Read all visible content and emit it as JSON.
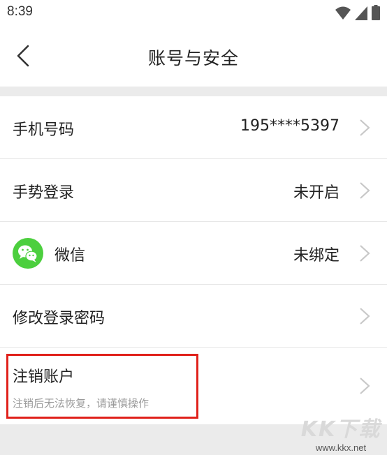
{
  "status_bar": {
    "time": "8:39",
    "icons": [
      "wifi-icon",
      "signal-icon",
      "battery-icon"
    ]
  },
  "header": {
    "title": "账号与安全",
    "back_icon": "back-arrow-icon"
  },
  "rows": [
    {
      "label": "手机号码",
      "value": "195****5397"
    },
    {
      "label": "手势登录",
      "value": "未开启"
    },
    {
      "label": "微信",
      "value": "未绑定",
      "icon": "wechat-icon"
    },
    {
      "label": "修改登录密码",
      "value": ""
    },
    {
      "label": "注销账户",
      "sublabel": "注销后无法恢复，请谨慎操作"
    }
  ],
  "annotation": {
    "highlight_color": "#e0211b"
  },
  "watermark": {
    "title": "KK下载",
    "url": "www.kkx.net"
  },
  "colors": {
    "wechat_green": "#4ccf3e",
    "background": "#ebebeb"
  }
}
